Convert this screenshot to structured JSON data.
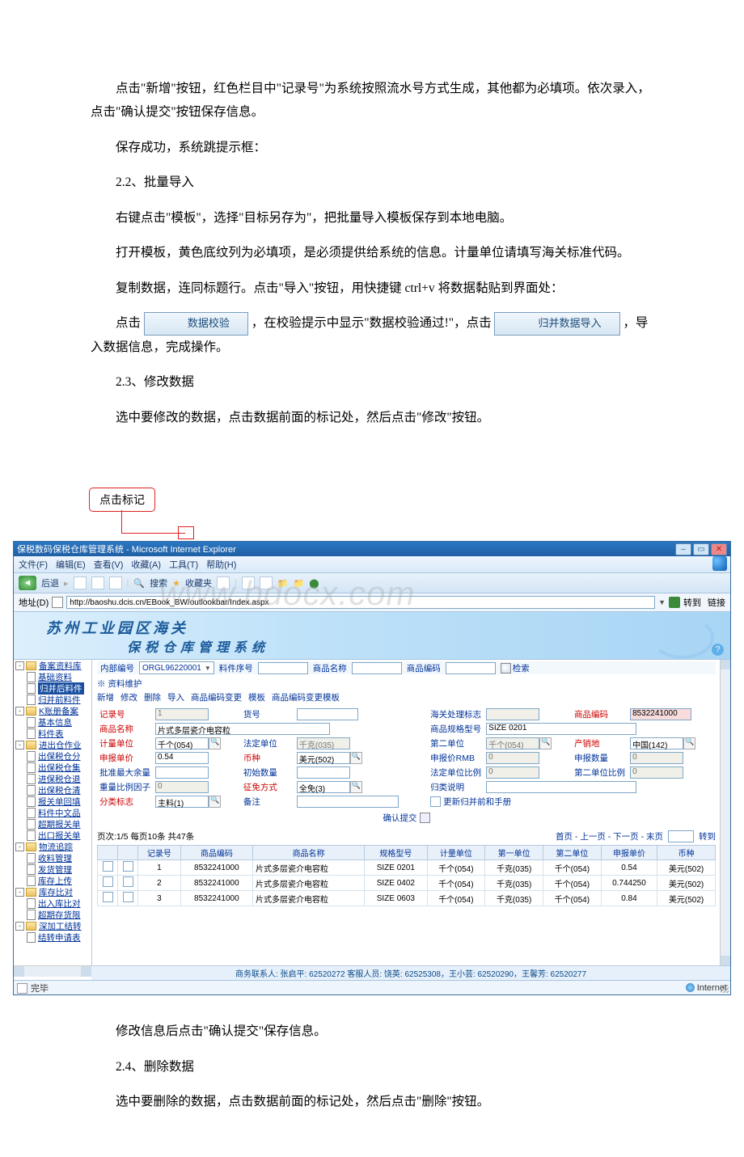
{
  "doc": {
    "p1": "点击\"新增\"按钮，红色栏目中\"记录号\"为系统按照流水号方式生成，其他都为必填项。依次录入，点击\"确认提交\"按钮保存信息。",
    "p2": "保存成功，系统跳提示框：",
    "p3": "2.2、批量导入",
    "p4": "右键点击\"模板\"，选择\"目标另存为\"，把批量导入模板保存到本地电脑。",
    "p5": "打开模板，黄色底纹列为必填项，是必须提供给系统的信息。计量单位请填写海关标准代码。",
    "p6": "复制数据，连同标题行。点击\"导入\"按钮，用快捷键 ctrl+v 将数据黏贴到界面处：",
    "p7a": "点击",
    "btn_validate": "数据校验",
    "p7b": "，在校验提示中显示\"数据校验通过!\"，点击",
    "btn_merge": "归并数据导入",
    "p7c": "，导入数据信息，完成操作。",
    "p8": "2.3、修改数据",
    "p9": "选中要修改的数据，点击数据前面的标记处，然后点击\"修改\"按钮。",
    "callout": "点击标记",
    "p10": "修改信息后点击\"确认提交\"保存信息。",
    "p11": "2.4、删除数据",
    "p12": "选中要删除的数据，点击数据前面的标记处，然后点击\"删除\"按钮。"
  },
  "ie": {
    "title": "保税数码保税仓库管理系统 - Microsoft Internet Explorer",
    "menu": {
      "file": "文件(F)",
      "edit": "编辑(E)",
      "view": "查看(V)",
      "fav": "收藏(A)",
      "tools": "工具(T)",
      "help": "帮助(H)"
    },
    "tb": {
      "back": "后退",
      "search": "搜索",
      "fav": "收藏夹"
    },
    "addr_label": "地址(D)",
    "addr": "http://baoshu.dcis.cn/EBook_BW/outlookbar/Index.aspx",
    "go": "转到",
    "links": "链接",
    "status_done": "完毕",
    "status_net": "Internet"
  },
  "watermark": "www.bdocx.com",
  "banner": {
    "l1": "苏州工业园区海关",
    "l2": "保税仓库管理系统"
  },
  "sidebar": {
    "n1": "备案资料库",
    "n1a": "基础资料",
    "n1b": "归并后料件",
    "n1c": "归并前料件",
    "n2": "K账册备案",
    "n2a": "基本信息",
    "n2b": "料件表",
    "n3": "进出仓作业",
    "n3a": "出保税仓分",
    "n3b": "出保税仓集",
    "n3c": "进保税仓退",
    "n3d": "出保税仓清",
    "n3e": "报关单回填",
    "n3f": "料件中文品",
    "n3g": "超期报关单",
    "n3h": "出口报关单",
    "n4": "物流追踪",
    "n4a": "收料管理",
    "n4b": "发货管理",
    "n4c": "库存上传",
    "n5": "库存比对",
    "n5a": "出入库比对",
    "n5b": "超期存货限",
    "n6": "深加工结转",
    "n6a": "结转申请表"
  },
  "filter": {
    "f1": "内部编号",
    "f1v": "ORGL96220001",
    "f2": "料件序号",
    "f3": "商品名称",
    "f4": "商品编码",
    "search": "检索"
  },
  "section": "※ 资料维护",
  "ops": {
    "add": "新增",
    "mod": "修改",
    "del": "删除",
    "imp": "导入",
    "chg1": "商品编码变更",
    "tpl": "模板",
    "chg2": "商品编码变更模板"
  },
  "form": {
    "record_no": "记录号",
    "record_no_v": "1",
    "huohao": "货号",
    "customs": "海关处理标志",
    "prod_code": "商品编码",
    "prod_code_v": "8532241000",
    "name": "商品名称",
    "name_v": "片式多层瓷介电容粒",
    "spec": "商品规格型号",
    "spec_v": "SIZE 0201",
    "unit": "计量单位",
    "unit_v": "千个(054)",
    "law_unit": "法定单位",
    "law_unit_v": "千克(035)",
    "unit2": "第二单位",
    "unit2_v": "千个(054)",
    "origin": "产销地",
    "origin_v": "中国(142)",
    "price": "申报单价",
    "price_v": "0.54",
    "curr": "币种",
    "curr_v": "美元(502)",
    "price_rmb": "申报价RMB",
    "price_rmb_v": "0",
    "qty": "申报数量",
    "qty_v": "0",
    "max": "批准最大余量",
    "init": "初始数量",
    "law_ratio": "法定单位比例",
    "law_ratio_v": "0",
    "ratio2": "第二单位比例",
    "ratio2_v": "0",
    "weight": "重量比例因子",
    "weight_v": "0",
    "zm": "征免方式",
    "zm_v": "全免(3)",
    "gl": "归类说明",
    "cat": "分类标志",
    "cat_v": "主料(1)",
    "note": "备注",
    "reorg": "更新归并前和手册"
  },
  "submit": "确认提交",
  "pager": {
    "info": "页次:1/5  每页10条  共47条",
    "nav": "首页 - 上一页 - 下一页 - 末页",
    "jump": "转到"
  },
  "grid": {
    "h": {
      "c1": "记录号",
      "c2": "商品编码",
      "c3": "商品名称",
      "c4": "规格型号",
      "c5": "计量单位",
      "c6": "第一单位",
      "c7": "第二单位",
      "c8": "申报单价",
      "c9": "币种"
    },
    "rows": [
      {
        "c1": "1",
        "c2": "8532241000",
        "c3": "片式多层瓷介电容粒",
        "c4": "SIZE 0201",
        "c5": "千个(054)",
        "c6": "千克(035)",
        "c7": "千个(054)",
        "c8": "0.54",
        "c9": "美元(502)"
      },
      {
        "c1": "2",
        "c2": "8532241000",
        "c3": "片式多层瓷介电容粒",
        "c4": "SIZE 0402",
        "c5": "千个(054)",
        "c6": "千克(035)",
        "c7": "千个(054)",
        "c8": "0.744250",
        "c9": "美元(502)"
      },
      {
        "c1": "3",
        "c2": "8532241000",
        "c3": "片式多层瓷介电容粒",
        "c4": "SIZE 0603",
        "c5": "千个(054)",
        "c6": "千克(035)",
        "c7": "千个(054)",
        "c8": "0.84",
        "c9": "美元(502)"
      }
    ]
  },
  "footer": "商务联系人: 张启平: 62520272 客服人员: 饶英: 62525308，王小芸: 62520290，王馨芳: 62520277"
}
